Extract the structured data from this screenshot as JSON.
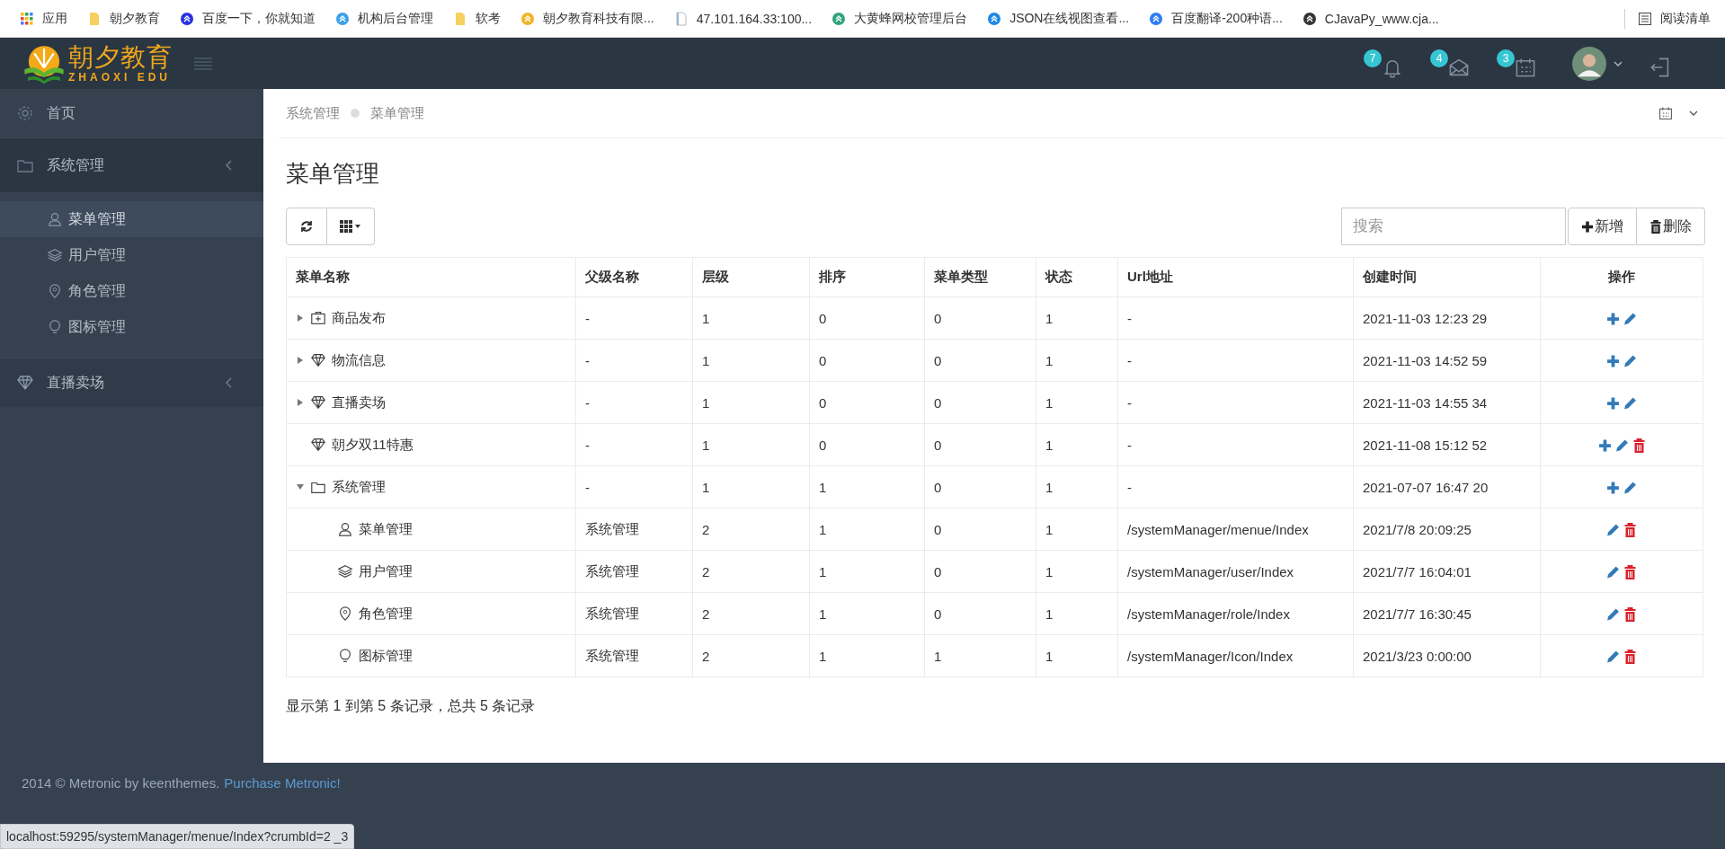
{
  "bookmarks": [
    {
      "label": "应用",
      "kind": "apps"
    },
    {
      "label": "朝夕教育",
      "kind": "folder",
      "color": "#f7d160"
    },
    {
      "label": "百度一下，你就知道",
      "kind": "site",
      "color": "#2932e1"
    },
    {
      "label": "机构后台管理",
      "kind": "site",
      "color": "#3aa0e8"
    },
    {
      "label": "软考",
      "kind": "folder",
      "color": "#f7d160"
    },
    {
      "label": "朝夕教育科技有限...",
      "kind": "site",
      "color": "#f0b429"
    },
    {
      "label": "47.101.164.33:100...",
      "kind": "page",
      "color": "#9bb7d4"
    },
    {
      "label": "大黄蜂网校管理后台",
      "kind": "site",
      "color": "#2fa37a"
    },
    {
      "label": "JSON在线视图查看...",
      "kind": "site",
      "color": "#1e88e5"
    },
    {
      "label": "百度翻译-200种语...",
      "kind": "site",
      "color": "#2b7cf6"
    },
    {
      "label": "CJavaPy_www.cja...",
      "kind": "site",
      "color": "#333333"
    }
  ],
  "reading_list": {
    "label": "阅读清单"
  },
  "header": {
    "logo": {
      "title": "朝夕教育",
      "subtitle": "ZHAOXI EDU"
    },
    "badges": [
      {
        "kind": "bell",
        "count": "7"
      },
      {
        "kind": "mail",
        "count": "4"
      },
      {
        "kind": "calendar",
        "count": "3"
      }
    ]
  },
  "sidebar": {
    "items": [
      {
        "label": "首页",
        "kind": "gear"
      },
      {
        "label": "系统管理",
        "kind": "folder",
        "expanded": true,
        "children": [
          {
            "label": "菜单管理",
            "kind": "user",
            "selected": true
          },
          {
            "label": "用户管理",
            "kind": "layers",
            "selected": false
          },
          {
            "label": "角色管理",
            "kind": "pin",
            "selected": false
          },
          {
            "label": "图标管理",
            "kind": "bulb",
            "selected": false
          }
        ]
      },
      {
        "label": "直播卖场",
        "kind": "diamond",
        "expanded": false
      }
    ]
  },
  "breadcrumb": [
    "系统管理",
    "菜单管理"
  ],
  "page_title": "菜单管理",
  "search": {
    "placeholder": "搜索"
  },
  "buttons": [
    {
      "kind": "add",
      "label": "新增"
    },
    {
      "kind": "delete",
      "label": "删除"
    }
  ],
  "table": {
    "columns": [
      "菜单名称",
      "父级名称",
      "层级",
      "排序",
      "菜单类型",
      "状态",
      "Url地址",
      "创建时间",
      "操作"
    ],
    "rows": [
      {
        "name": "商品发布",
        "kind": "medkit",
        "expanded": false,
        "parent": "-",
        "level_no": "1",
        "sort": "0",
        "type": "0",
        "status": "1",
        "url": "-",
        "created": "2021-11-03 12:23 29",
        "can_add": true,
        "can_edit": true,
        "can_delete": false
      },
      {
        "name": "物流信息",
        "kind": "diamond",
        "expanded": false,
        "parent": "-",
        "level_no": "1",
        "sort": "0",
        "type": "0",
        "status": "1",
        "url": "-",
        "created": "2021-11-03 14:52 59",
        "can_add": true,
        "can_edit": true,
        "can_delete": false
      },
      {
        "name": "直播卖场",
        "kind": "diamond",
        "expanded": false,
        "parent": "-",
        "level_no": "1",
        "sort": "0",
        "type": "0",
        "status": "1",
        "url": "-",
        "created": "2021-11-03 14:55 34",
        "can_add": true,
        "can_edit": true,
        "can_delete": false
      },
      {
        "name": "朝夕双11特惠",
        "kind": "diamond",
        "parent": "-",
        "level_no": "1",
        "sort": "0",
        "type": "0",
        "status": "1",
        "url": "-",
        "created": "2021-11-08 15:12 52",
        "can_add": true,
        "can_edit": true,
        "can_delete": true
      },
      {
        "name": "系统管理",
        "kind": "folder",
        "expanded": true,
        "parent": "-",
        "level_no": "1",
        "sort": "1",
        "type": "0",
        "status": "1",
        "url": "-",
        "created": "2021-07-07 16:47 20",
        "can_add": true,
        "can_edit": true,
        "can_delete": false,
        "children": [
          {
            "name": "菜单管理",
            "kind": "user",
            "parent": "系统管理",
            "level_no": "2",
            "sort": "1",
            "type": "0",
            "status": "1",
            "url": "/systemManager/menue/Index",
            "created": "2021/7/8 20:09:25",
            "can_add": false,
            "can_edit": true,
            "can_delete": true
          },
          {
            "name": "用户管理",
            "kind": "layers",
            "parent": "系统管理",
            "level_no": "2",
            "sort": "1",
            "type": "0",
            "status": "1",
            "url": "/systemManager/user/Index",
            "created": "2021/7/7 16:04:01",
            "can_add": false,
            "can_edit": true,
            "can_delete": true
          },
          {
            "name": "角色管理",
            "kind": "pin",
            "parent": "系统管理",
            "level_no": "2",
            "sort": "1",
            "type": "0",
            "status": "1",
            "url": "/systemManager/role/Index",
            "created": "2021/7/7 16:30:45",
            "can_add": false,
            "can_edit": true,
            "can_delete": true
          },
          {
            "name": "图标管理",
            "kind": "bulb",
            "parent": "系统管理",
            "level_no": "2",
            "sort": "1",
            "type": "1",
            "status": "1",
            "url": "/systemManager/Icon/Index",
            "created": "2021/3/23 0:00:00",
            "can_add": false,
            "can_edit": true,
            "can_delete": true
          }
        ]
      }
    ]
  },
  "pagination": "显示第 1 到第 5 条记录，总共 5 条记录",
  "footer": {
    "text": "2014 © Metronic by keenthemes.",
    "link": "Purchase Metronic!"
  },
  "status_bar": "localhost:59295/systemManager/menue/Index?crumbId=2 _3"
}
